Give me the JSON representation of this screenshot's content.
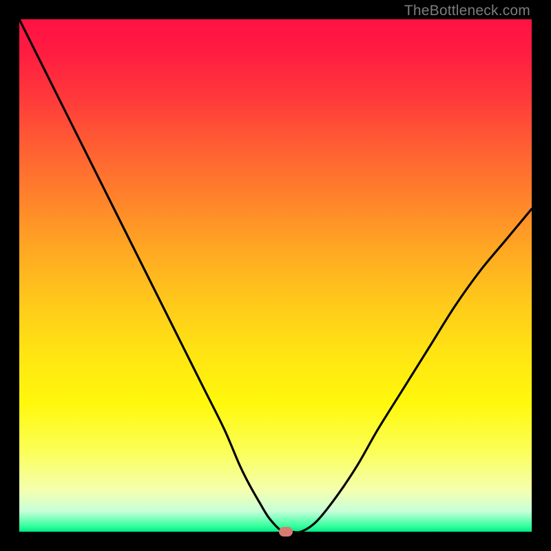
{
  "watermark": "TheBottleneck.com",
  "colors": {
    "frame": "#000000",
    "curve": "#000000",
    "marker": "#d87b70"
  },
  "chart_data": {
    "type": "line",
    "title": "",
    "xlabel": "",
    "ylabel": "",
    "xlim": [
      0,
      100
    ],
    "ylim": [
      0,
      100
    ],
    "x": [
      0,
      2,
      5,
      8,
      12,
      16,
      20,
      24,
      28,
      32,
      36,
      40,
      43,
      45,
      47,
      48.5,
      50,
      51,
      52,
      53,
      55,
      58,
      62,
      66,
      70,
      75,
      80,
      85,
      90,
      95,
      100
    ],
    "values": [
      100,
      96,
      90,
      84,
      76,
      68,
      60,
      52,
      44,
      36,
      28,
      20,
      13,
      9,
      5.5,
      3,
      1.2,
      0.3,
      0,
      0,
      0,
      2,
      7,
      13,
      20,
      28,
      36,
      44,
      51,
      57,
      63
    ],
    "marker": {
      "x": 52,
      "y": 0
    },
    "note": "Values are percentages read from the unlabeled gradient axes; y=0 at the green bottom, y=100 at the red top."
  }
}
